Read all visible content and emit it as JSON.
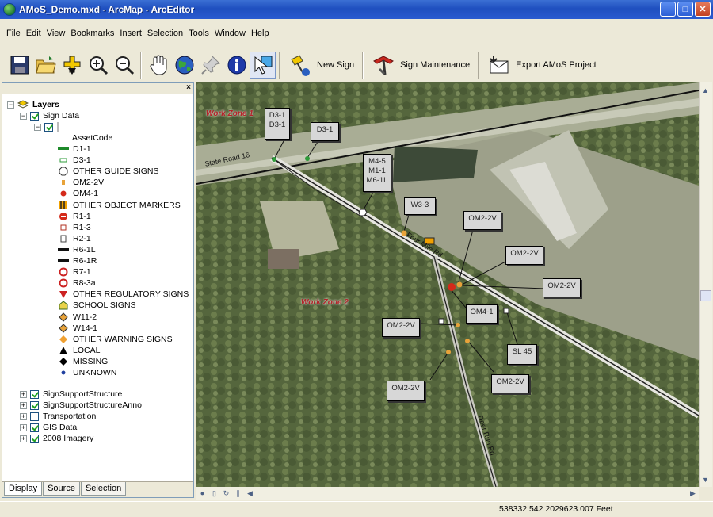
{
  "window": {
    "title": "AMoS_Demo.mxd - ArcMap - ArcEditor",
    "minimize": "_",
    "maximize": "□",
    "close": "✕"
  },
  "menu": [
    "File",
    "Edit",
    "View",
    "Bookmarks",
    "Insert",
    "Selection",
    "Tools",
    "Window",
    "Help"
  ],
  "toolbar": {
    "tools": [
      {
        "name": "save-icon"
      },
      {
        "name": "open-folder-icon"
      },
      {
        "name": "add-data-icon"
      },
      {
        "name": "zoom-in-icon"
      },
      {
        "name": "zoom-out-icon"
      },
      {
        "name": "pan-hand-icon"
      },
      {
        "name": "full-extent-globe-icon"
      },
      {
        "name": "identify-pushpin-icon"
      },
      {
        "name": "info-icon"
      },
      {
        "name": "select-elements-icon"
      }
    ],
    "new_sign": "New Sign",
    "sign_maintenance": "Sign Maintenance",
    "export_project": "Export AMoS Project"
  },
  "toc": {
    "close": "×",
    "root": "Layers",
    "layer_sign_data": "Sign Data",
    "field": "AssetCode",
    "legend": [
      {
        "label": "D1-1",
        "icon": "green-bar",
        "color": "#1e8a2a"
      },
      {
        "label": "D3-1",
        "icon": "green-small",
        "color": "#2e9b3a"
      },
      {
        "label": "OTHER GUIDE SIGNS",
        "icon": "guide-octagon",
        "color": "#333333"
      },
      {
        "label": "OM2-2V",
        "icon": "orange-dot",
        "color": "#e8a33a"
      },
      {
        "label": "OM4-1",
        "icon": "red-diamond",
        "color": "#d42a1a"
      },
      {
        "label": "OTHER OBJECT MARKERS",
        "icon": "striped-marker",
        "color": "#f0a000"
      },
      {
        "label": "R1-1",
        "icon": "stop-sign",
        "color": "#d42a1a"
      },
      {
        "label": "R1-3",
        "icon": "small-rect",
        "color": "#b03020"
      },
      {
        "label": "R2-1",
        "icon": "speed-limit",
        "color": "#444444"
      },
      {
        "label": "R6-1L",
        "icon": "black-bar",
        "color": "#111111"
      },
      {
        "label": "R6-1R",
        "icon": "black-bar",
        "color": "#111111"
      },
      {
        "label": "R7-1",
        "icon": "no-parking",
        "color": "#cc2222"
      },
      {
        "label": "R8-3a",
        "icon": "no-parking",
        "color": "#cc2222"
      },
      {
        "label": "OTHER REGULATORY SIGNS",
        "icon": "red-triangle",
        "color": "#cc2222"
      },
      {
        "label": "SCHOOL SIGNS",
        "icon": "school-pentagon",
        "color": "#3a6a1a"
      },
      {
        "label": "W11-2",
        "icon": "warning-diamond",
        "color": "#e8a33a"
      },
      {
        "label": "W14-1",
        "icon": "warning-diamond",
        "color": "#e8a33a"
      },
      {
        "label": "OTHER WARNING SIGNS",
        "icon": "orange-diamond",
        "color": "#f0a030"
      },
      {
        "label": "LOCAL",
        "icon": "black-triangle",
        "color": "#000000"
      },
      {
        "label": "MISSING",
        "icon": "black-diamond",
        "color": "#000000"
      },
      {
        "label": "UNKNOWN",
        "icon": "blue-dot",
        "color": "#2040a0"
      }
    ],
    "layers": [
      {
        "label": "SignSupportStructure",
        "checked": true
      },
      {
        "label": "SignSupportStructureAnno",
        "checked": true
      },
      {
        "label": "Transportation",
        "checked": false
      },
      {
        "label": "GIS Data",
        "checked": true
      },
      {
        "label": "2008 Imagery",
        "checked": true
      }
    ],
    "tabs": [
      "Display",
      "Source",
      "Selection"
    ]
  },
  "map": {
    "zones": [
      "Work Zone 1",
      "Work Zone 2"
    ],
    "roads": [
      "State Road 16",
      "Four Mile Rd",
      "Deer Run Rd"
    ],
    "callouts": [
      {
        "id": "d3-1-pair",
        "lines": [
          "D3-1",
          "D3-1"
        ]
      },
      {
        "id": "d3-1",
        "lines": [
          "D3-1"
        ]
      },
      {
        "id": "m4-5",
        "lines": [
          "M4-5",
          "M1-1",
          "M6-1L"
        ]
      },
      {
        "id": "w3-3",
        "lines": [
          "W3-3"
        ]
      },
      {
        "id": "om2-a",
        "lines": [
          "OM2-2V"
        ]
      },
      {
        "id": "om2-b",
        "lines": [
          "OM2-2V"
        ]
      },
      {
        "id": "om2-c",
        "lines": [
          "OM2-2V"
        ]
      },
      {
        "id": "om4-1",
        "lines": [
          "OM4-1"
        ]
      },
      {
        "id": "om2-d",
        "lines": [
          "OM2-2V"
        ]
      },
      {
        "id": "sl-45",
        "lines": [
          "SL 45"
        ]
      },
      {
        "id": "om2-e",
        "lines": [
          "OM2-2V"
        ]
      },
      {
        "id": "om2-f",
        "lines": [
          "OM2-2V"
        ]
      }
    ]
  },
  "status": {
    "coordinates": "538332.542  2029623.007 Feet"
  }
}
